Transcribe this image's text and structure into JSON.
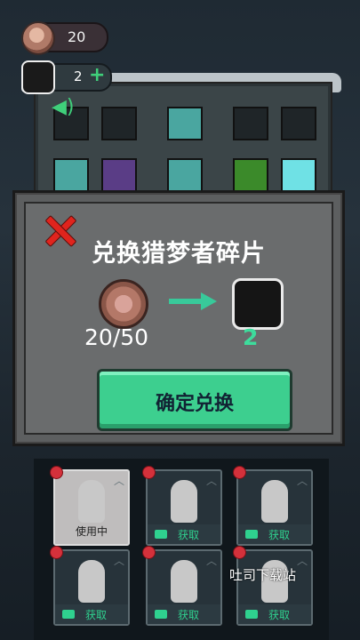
{
  "hud": {
    "coin_count": "20",
    "piece_count": "2",
    "add_symbol": "+"
  },
  "dialog": {
    "title": "兑换猎梦者碎片",
    "cost": "20/50",
    "gain": "2",
    "confirm_label": "确定兑换"
  },
  "roster": {
    "cards": [
      {
        "status": "使用中"
      },
      {
        "status": "获取"
      },
      {
        "status": "获取"
      },
      {
        "status": "获取"
      },
      {
        "status": "获取"
      },
      {
        "status": "获取"
      }
    ]
  },
  "watermark": "吐司下载站",
  "colors": {
    "accent": "#3dcf8f",
    "close": "#e0241d",
    "badge": "#d4313b"
  }
}
